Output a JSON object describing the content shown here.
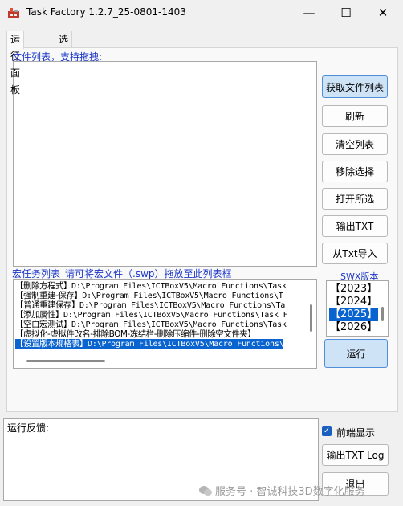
{
  "window": {
    "title": "Task Factory 1.2.7_25-0801-1403",
    "minimize_glyph": "—",
    "maximize_glyph": "☐",
    "close_glyph": "✕"
  },
  "tabs": [
    {
      "label": "运行面板",
      "active": true
    },
    {
      "label": "选项",
      "active": false
    }
  ],
  "file_list": {
    "label": "文件列表，支持拖拽:"
  },
  "buttons": {
    "get_file_list": "获取文件列表",
    "refresh": "刷新",
    "clear_list": "清空列表",
    "remove_selected": "移除选择",
    "open_selected": "打开所选",
    "export_txt": "输出TXT",
    "import_txt": "从Txt导入",
    "run": "运行",
    "export_txt_log": "输出TXT Log",
    "exit": "退出"
  },
  "macro_list": {
    "label": "宏任务列表_请可将宏文件（.swp）拖放至此列表框",
    "items": [
      {
        "tag": "【删除方程式】",
        "path": "D:\\Program Files\\ICTBoxV5\\Macro Functions\\Task",
        "selected": false
      },
      {
        "tag": "【强制重建-保存】",
        "path": "D:\\Program Files\\ICTBoxV5\\Macro Functions\\T",
        "selected": false
      },
      {
        "tag": "【普通重建保存】",
        "path": "D:\\Program Files\\ICTBoxV5\\Macro Functions\\Ta",
        "selected": false
      },
      {
        "tag": "【添加属性】",
        "path": "D:\\Program Files\\ICTBoxV5\\Macro Functions\\Task F",
        "selected": false
      },
      {
        "tag": "【空白宏测试】",
        "path": "D:\\Program Files\\ICTBoxV5\\Macro Functions\\Task",
        "selected": false
      },
      {
        "tag": "【虚拟化-虚拟件改名-排除BOM-冻结栏-删除压缩件-删除空文件夹】",
        "path": "",
        "selected": false
      },
      {
        "tag": "【设置版本规格表】",
        "path": "D:\\Program Files\\ICTBoxV5\\Macro Functions\\",
        "selected": true
      }
    ]
  },
  "swx_version": {
    "label": "SWX版本",
    "options": [
      {
        "label": "【2023】",
        "selected": false
      },
      {
        "label": "【2024】",
        "selected": false
      },
      {
        "label": "【2025】",
        "selected": true
      },
      {
        "label": "【2026】",
        "selected": false
      }
    ]
  },
  "feedback": {
    "label": "运行反馈:"
  },
  "frontend_display": {
    "label": "前端显示",
    "checked": true,
    "check_glyph": "✓"
  },
  "watermark": {
    "text": "服务号 · 智诚科技3D数字化服务"
  }
}
